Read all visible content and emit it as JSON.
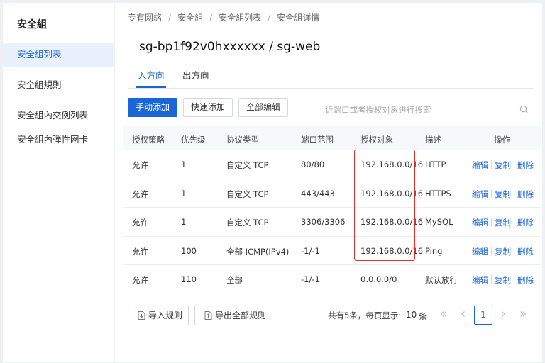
{
  "sidebar": {
    "title": "安全組",
    "items": [
      {
        "label": "安全組列表",
        "active": true
      },
      {
        "label": "安全組規則",
        "active": false
      },
      {
        "label": "安全組內交例列表",
        "active": false
      },
      {
        "label": "安全組內弾性网卡",
        "active": false
      }
    ]
  },
  "breadcrumb": [
    "专有网絡",
    "安全組",
    "安全組列表",
    "安全組详情"
  ],
  "page_title": "sg-bp1f92v0hxxxxxx / sg-web",
  "tabs": [
    {
      "label": "入方向",
      "active": true
    },
    {
      "label": "出方向",
      "active": false
    }
  ],
  "toolbar": {
    "manual_add": "手动添加",
    "quick_add": "快速添加",
    "edit_all": "全部编辑",
    "search_placeholder": "䜣端口或者授权对象进行搜索"
  },
  "table": {
    "headers": [
      "授权策略",
      "优先级",
      "协议类型",
      "端口范围",
      "授权对象",
      "描述",
      "操作"
    ],
    "rows": [
      {
        "policy": "允许",
        "priority": "1",
        "protocol": "自定义 TCP",
        "port": "80/80",
        "source": "192.168.0.0/16",
        "desc": "HTTP"
      },
      {
        "policy": "允许",
        "priority": "1",
        "protocol": "自定义 TCP",
        "port": "443/443",
        "source": "192.168.0.0/16",
        "desc": "HTTPS"
      },
      {
        "policy": "允许",
        "priority": "1",
        "protocol": "自定义 TCP",
        "port": "3306/3306",
        "source": "192.168.0.0/16",
        "desc": "MySQL"
      },
      {
        "policy": "允许",
        "priority": "100",
        "protocol": "全部 ICMP(IPv4)",
        "port": "-1/-1",
        "source": "192.168.0.0/16",
        "desc": "Ping"
      },
      {
        "policy": "允许",
        "priority": "110",
        "protocol": "全部",
        "port": "-1/-1",
        "source": "0.0.0.0/0",
        "desc": "默认放行"
      }
    ],
    "actions": [
      "编辑",
      "复制",
      "删除"
    ]
  },
  "footer": {
    "import_label": "导入规则",
    "export_label": "导出全部规则",
    "total_text": "共有5条，每页显示:",
    "page_size": "10",
    "page_size_unit": "条",
    "current_page": "1"
  },
  "colors": {
    "accent": "#1a66d8",
    "highlight": "#e0302a"
  },
  "icons": {
    "search": "search-icon",
    "import": "file-import-icon",
    "export": "file-export-icon",
    "first_page": "double-chevron-left-icon",
    "prev_page": "chevron-left-icon",
    "next_page": "chevron-right-icon",
    "last_page": "double-chevron-right-icon"
  }
}
